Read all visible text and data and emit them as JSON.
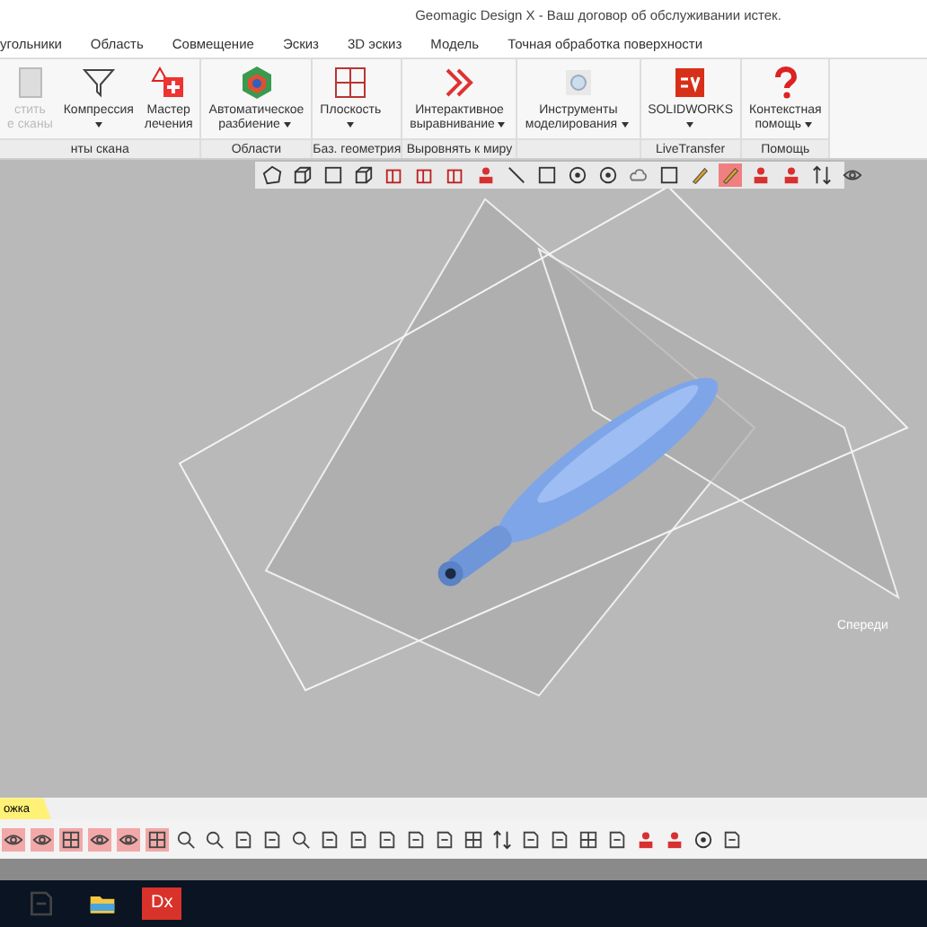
{
  "window": {
    "title": "Geomagic Design X - Ваш договор об обслуживании истек."
  },
  "ribbon_tabs": [
    "угольники",
    "Область",
    "Совмещение",
    "Эскиз",
    "3D эскиз",
    "Модель",
    "Точная обработка поверхности"
  ],
  "ribbon_groups": [
    {
      "label": "нты скана",
      "buttons": [
        {
          "lines": [
            "стить",
            "е сканы"
          ],
          "disabled": true,
          "dropdown": false
        },
        {
          "lines": [
            "Компрессия"
          ],
          "disabled": false,
          "dropdown": true
        },
        {
          "lines": [
            "Мастер",
            "лечения"
          ],
          "disabled": false,
          "dropdown": false
        }
      ]
    },
    {
      "label": "Области",
      "buttons": [
        {
          "lines": [
            "Автоматическое",
            "разбиение"
          ],
          "disabled": false,
          "dropdown": true
        }
      ]
    },
    {
      "label": "Баз. геометрия",
      "buttons": [
        {
          "lines": [
            "Плоскость"
          ],
          "disabled": false,
          "dropdown": true
        }
      ]
    },
    {
      "label": "Выровнять к миру",
      "buttons": [
        {
          "lines": [
            "Интерактивное",
            "выравнивание"
          ],
          "disabled": false,
          "dropdown": true
        }
      ]
    },
    {
      "buttons": [
        {
          "lines": [
            "Инструменты",
            "моделирования"
          ],
          "disabled": false,
          "dropdown": true
        }
      ]
    },
    {
      "label": "LiveTransfer",
      "buttons": [
        {
          "lines": [
            "SOLIDWORKS"
          ],
          "disabled": false,
          "dropdown": true
        }
      ]
    },
    {
      "label": "Помощь",
      "buttons": [
        {
          "lines": [
            "Контекстная",
            "помощь"
          ],
          "disabled": false,
          "dropdown": true
        }
      ]
    }
  ],
  "view_toolbar": [
    {
      "selected": false
    },
    {
      "selected": false
    },
    {
      "selected": false
    },
    {
      "selected": false
    },
    {
      "selected": false
    },
    {
      "selected": false
    },
    {
      "selected": false
    },
    {
      "selected": false
    },
    {
      "selected": false
    },
    {
      "selected": false
    },
    {
      "selected": false
    },
    {
      "selected": false
    },
    {
      "selected": false
    },
    {
      "selected": false
    },
    {
      "selected": false
    },
    {
      "selected": true
    },
    {
      "selected": false
    },
    {
      "selected": false
    },
    {
      "selected": false
    },
    {
      "selected": false
    }
  ],
  "viewport": {
    "view_label": "Спереди"
  },
  "bottom_tab": {
    "label": "ожка"
  },
  "bottom_toolbar": [
    {
      "on": true
    },
    {
      "on": true
    },
    {
      "on": true
    },
    {
      "on": true
    },
    {
      "on": true
    },
    {
      "on": true
    },
    {
      "on": false
    },
    {
      "on": false
    },
    {
      "on": false
    },
    {
      "on": false
    },
    {
      "on": false
    },
    {
      "on": false
    },
    {
      "on": false
    },
    {
      "on": false
    },
    {
      "on": false
    },
    {
      "on": false
    },
    {
      "on": false
    },
    {
      "on": false
    },
    {
      "on": false
    },
    {
      "on": false
    },
    {
      "on": false
    },
    {
      "on": false
    },
    {
      "on": false
    },
    {
      "on": false
    },
    {
      "on": false
    },
    {
      "on": false
    }
  ],
  "taskbar": {
    "app_label": "Dx"
  }
}
